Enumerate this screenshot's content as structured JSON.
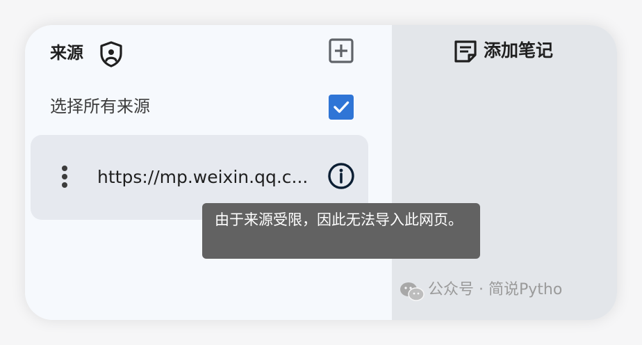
{
  "sources_panel": {
    "title": "来源",
    "select_all_label": "选择所有来源",
    "select_all_checked": true,
    "items": [
      {
        "url_text": "https://mp.weixin.qq.c..."
      }
    ]
  },
  "tooltip": {
    "text": "由于来源受限，因此无法导入此网页。"
  },
  "notes_panel": {
    "add_note_label": "添加笔记"
  },
  "watermark": {
    "text": "公众号 · 简说Pytho"
  },
  "colors": {
    "accent": "#2f75d6",
    "tooltip_bg": "#626262",
    "right_panel_bg": "#e3e6ea",
    "item_bg": "#e6e9ef"
  },
  "icons": [
    "shield-icon",
    "add-box-icon",
    "checkmark-icon",
    "more-vert-icon",
    "info-icon",
    "sticky-note-icon",
    "wechat-icon"
  ]
}
